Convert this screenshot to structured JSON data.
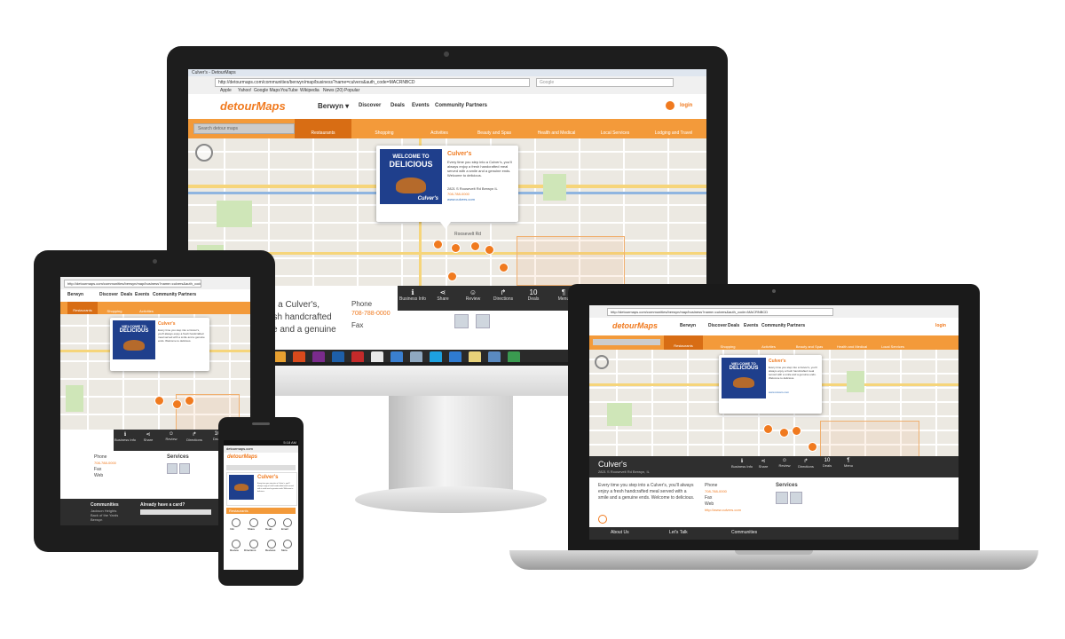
{
  "colors": {
    "brand_orange": "#f07a1f",
    "category_bar": "#f39a3a",
    "action_bar": "#2f2f2f",
    "popup_blue": "#1f3f8c"
  },
  "browser": {
    "tab_title": "Culver's - DetourMaps",
    "url": "http://detourmaps.com/communities/berwyn/map/business?name=culvers&auth_code=MACRNBCD",
    "search_placeholder": "Google",
    "bookmarks": [
      "Apple",
      "Yahoo!",
      "Google Maps",
      "YouTube",
      "Wikipedia",
      "News (20)",
      "Popular"
    ]
  },
  "site": {
    "logo": "detourMaps",
    "logo_sub": "beta",
    "community": "Berwyn",
    "nav": [
      "Discover",
      "Deals",
      "Events",
      "Community Partners"
    ],
    "login": "login",
    "search_placeholder": "Search detour maps",
    "categories": [
      "Restaurants",
      "Shopping",
      "Activities",
      "Beauty and Spas",
      "Health and Medical",
      "Local Services",
      "Lodging and Travel"
    ]
  },
  "popup": {
    "image_text_1": "WELCOME TO",
    "image_text_2": "DELICIOUS",
    "brand": "Culver's",
    "title": "Culver's",
    "text": "Every time you step into a Culver's, you'll always enjoy a fresh handcrafted meal served with a smile and a genuine ends. Welcome to delicious.",
    "address": "2821 S Roosevelt Rd Berwyn IL",
    "phone": "708-788-0000",
    "link": "www.culvers.com",
    "street_label": "Roosevelt Rd"
  },
  "actions": [
    {
      "icon": "info-icon",
      "glyph": "ℹ",
      "label": "Business Info"
    },
    {
      "icon": "share-icon",
      "glyph": "⋖",
      "label": "Share"
    },
    {
      "icon": "review-icon",
      "glyph": "☺",
      "label": "Review"
    },
    {
      "icon": "directions-icon",
      "glyph": "↱",
      "label": "Directions"
    },
    {
      "icon": "deals-icon",
      "glyph": "10",
      "label": "Deals"
    },
    {
      "icon": "menu-icon",
      "glyph": "¶",
      "label": "Menu"
    }
  ],
  "details": {
    "name": "Culver's",
    "address": "2821 S Roosevelt Rd Berwyn, IL",
    "description": "Every time you step into a Culver's, you'll always enjoy a fresh handcrafted meal served with a smile and a genuine ends. Welcome to delicious.",
    "desktop_desc_line1": "to a Culver's,",
    "desktop_desc_line2": "esh handcrafted",
    "desktop_desc_line3": "ite and a genuine",
    "phone_label": "Phone",
    "phone": "708-788-0000",
    "fax_label": "Fax",
    "web_label": "Web",
    "web": "http://www.culvers.com",
    "services_label": "Services",
    "more_label": "More"
  },
  "footer": {
    "about": "About Us",
    "communities": "Communities",
    "card": "Already have a card?",
    "lets_talk": "Let's Talk",
    "c1": "Jackson Heights",
    "c2": "Back of the Yards",
    "c3": "Berwyn"
  },
  "phone_ui": {
    "status_time": "5:18 AM",
    "url": "detourmaps.com",
    "section": "Restaurants",
    "icons": [
      "Info",
      "Share",
      "Deals",
      "Email",
      "Review",
      "Directions",
      "Reviews",
      "More"
    ]
  }
}
